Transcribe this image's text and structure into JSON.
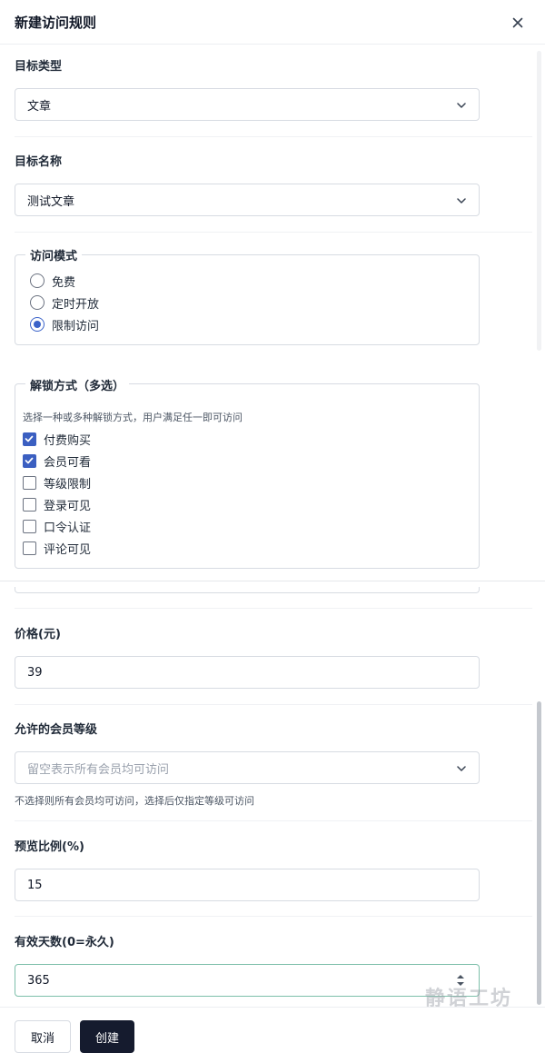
{
  "dialog": {
    "title": "新建访问规则",
    "close_icon": "close-icon"
  },
  "target_type": {
    "label": "目标类型",
    "value": "文章"
  },
  "target_name": {
    "label": "目标名称",
    "value": "测试文章"
  },
  "access_mode": {
    "legend": "访问模式",
    "options": [
      {
        "label": "免费",
        "selected": false
      },
      {
        "label": "定时开放",
        "selected": false
      },
      {
        "label": "限制访问",
        "selected": true
      }
    ]
  },
  "unlock": {
    "legend": "解锁方式（多选）",
    "hint": "选择一种或多种解锁方式，用户满足任一即可访问",
    "options": [
      {
        "label": "付费购买",
        "checked": true
      },
      {
        "label": "会员可看",
        "checked": true
      },
      {
        "label": "等级限制",
        "checked": false
      },
      {
        "label": "登录可见",
        "checked": false
      },
      {
        "label": "口令认证",
        "checked": false
      },
      {
        "label": "评论可见",
        "checked": false
      }
    ]
  },
  "price": {
    "label": "价格(元)",
    "value": "39"
  },
  "member_level": {
    "label": "允许的会员等级",
    "placeholder": "留空表示所有会员均可访问",
    "hint": "不选择则所有会员均可访问，选择后仅指定等级可访问"
  },
  "preview_ratio": {
    "label": "预览比例(%)",
    "value": "15"
  },
  "valid_days": {
    "label": "有效天数(0=永久)",
    "value": "365"
  },
  "footer": {
    "cancel_label": "取消",
    "create_label": "创建"
  },
  "watermark": "静语工坊",
  "colors": {
    "accent": "#3b5fc1",
    "primary_button": "#151b2e",
    "focus_border": "#7dbfaa"
  }
}
